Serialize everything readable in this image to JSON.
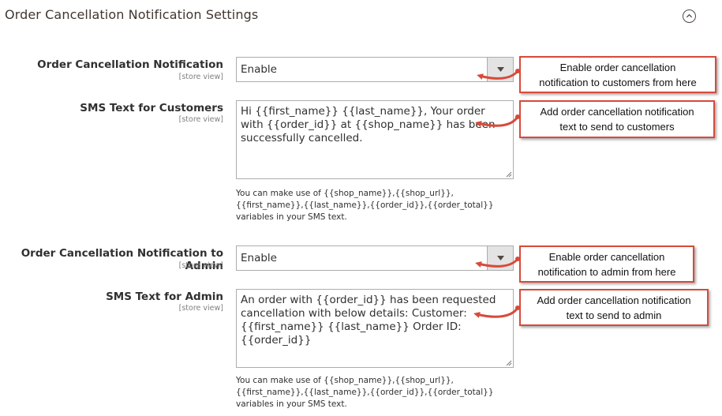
{
  "section": {
    "title": "Order Cancellation Notification Settings",
    "collapse_icon": "chevron-up-circle-icon"
  },
  "fields": {
    "customer_notification": {
      "label": "Order Cancellation Notification",
      "scope": "[store view]",
      "value": "Enable"
    },
    "customer_sms": {
      "label": "SMS Text for Customers",
      "scope": "[store view]",
      "value": "Hi {{first_name}} {{last_name}}, Your order with {{order_id}} at {{shop_name}} has been successfully cancelled.",
      "note_line1": "You can make use of {{shop_name}},{{shop_url}},",
      "note_line2": "{{first_name}},{{last_name}},{{order_id}},{{order_total}}",
      "note_line3": "variables in your SMS text."
    },
    "admin_notification": {
      "label": "Order Cancellation Notification to Admin",
      "scope": "[store view]",
      "value": "Enable"
    },
    "admin_sms": {
      "label": "SMS Text for Admin",
      "scope": "[store view]",
      "value": "An order with {{order_id}} has been requested cancellation with below details: Customer: {{first_name}} {{last_name}} Order ID: {{order_id}}",
      "note_line1": "You can make use of {{shop_name}},{{shop_url}},",
      "note_line2": "{{first_name}},{{last_name}},{{order_id}},{{order_total}}",
      "note_line3": "variables in your SMS text."
    }
  },
  "callouts": {
    "c1_line1": "Enable order cancellation",
    "c1_line2": "notification to customers from here",
    "c2_line1": "Add order cancellation notification",
    "c2_line2": "text to send to customers",
    "c3_line1": "Enable order cancellation",
    "c3_line2": "notification to admin from here",
    "c4_line1": "Add order cancellation notification",
    "c4_line2": "text to send to admin"
  },
  "colors": {
    "callout_border": "#d84a3a",
    "arrow": "#d84a3a",
    "select_arrow_bg": "#e3e3e3"
  }
}
